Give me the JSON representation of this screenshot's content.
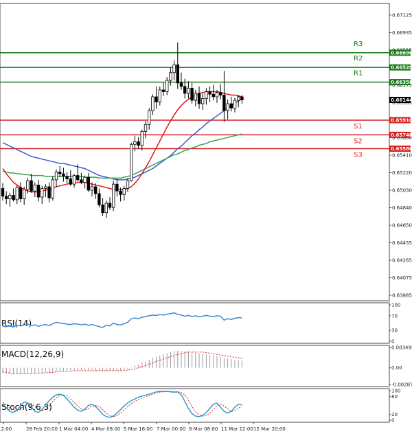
{
  "chart_data": {
    "type": "candlestick",
    "main": {
      "price_axis_ticks": [
        "0.67125",
        "0.66935",
        "0.66555",
        "0.66365",
        "0.66175",
        "0.65985",
        "0.65790",
        "0.65600",
        "0.65410",
        "0.65220",
        "0.65030",
        "0.64840",
        "0.64650",
        "0.64455",
        "0.64265",
        "0.64075",
        "0.63885"
      ],
      "ylim": [
        0.63885,
        0.67125
      ],
      "current_price": "0.66144",
      "resistance": [
        {
          "name": "R3",
          "value": "0.66690"
        },
        {
          "name": "R2",
          "value": "0.66520"
        },
        {
          "name": "R1",
          "value": "0.66350"
        }
      ],
      "support": [
        {
          "name": "S1",
          "value": "0.65910"
        },
        {
          "name": "S2",
          "value": "0.65740"
        },
        {
          "name": "S3",
          "value": "0.65580"
        }
      ],
      "x_labels": [
        "12:00",
        "28 Feb 20:00",
        "1 Mar 04:00",
        "4 Mar 08:00",
        "5 Mar 16:00",
        "7 Mar 00:00",
        "8 Mar 08:00",
        "11 Mar 12:00",
        "12 Mar 20:00"
      ],
      "candles": [
        [
          0.6512,
          0.6518,
          0.6498,
          0.6503
        ],
        [
          0.6503,
          0.6509,
          0.6494,
          0.65
        ],
        [
          0.65,
          0.6507,
          0.6491,
          0.6504
        ],
        [
          0.6504,
          0.6512,
          0.6497,
          0.6499
        ],
        [
          0.6499,
          0.6516,
          0.6494,
          0.6513
        ],
        [
          0.6513,
          0.6519,
          0.6496,
          0.65
        ],
        [
          0.65,
          0.6514,
          0.6493,
          0.6511
        ],
        [
          0.6511,
          0.6524,
          0.6506,
          0.6521
        ],
        [
          0.6521,
          0.6529,
          0.6507,
          0.6509
        ],
        [
          0.6509,
          0.6519,
          0.6502,
          0.6516
        ],
        [
          0.6516,
          0.6522,
          0.6497,
          0.6502
        ],
        [
          0.6502,
          0.6515,
          0.6494,
          0.6512
        ],
        [
          0.6512,
          0.6517,
          0.6502,
          0.6514
        ],
        [
          0.6514,
          0.6519,
          0.6496,
          0.6501
        ],
        [
          0.6501,
          0.6526,
          0.6498,
          0.6522
        ],
        [
          0.6522,
          0.6534,
          0.6514,
          0.6531
        ],
        [
          0.6531,
          0.6538,
          0.6525,
          0.6529
        ],
        [
          0.6529,
          0.6536,
          0.652,
          0.6526
        ],
        [
          0.6526,
          0.6531,
          0.6518,
          0.6523
        ],
        [
          0.6523,
          0.6533,
          0.6515,
          0.6517
        ],
        [
          0.6517,
          0.6529,
          0.6513,
          0.6527
        ],
        [
          0.6527,
          0.654,
          0.652,
          0.6522
        ],
        [
          0.6522,
          0.653,
          0.6517,
          0.6519
        ],
        [
          0.6519,
          0.6527,
          0.6512,
          0.6525
        ],
        [
          0.6525,
          0.653,
          0.6508,
          0.651
        ],
        [
          0.651,
          0.6519,
          0.6503,
          0.6514
        ],
        [
          0.6514,
          0.6518,
          0.65,
          0.6506
        ],
        [
          0.6506,
          0.6512,
          0.649,
          0.6493
        ],
        [
          0.6493,
          0.6501,
          0.648,
          0.6484
        ],
        [
          0.6484,
          0.6498,
          0.6478,
          0.6495
        ],
        [
          0.6495,
          0.6502,
          0.6487,
          0.649
        ],
        [
          0.649,
          0.6521,
          0.6486,
          0.6517
        ],
        [
          0.6517,
          0.6523,
          0.6503,
          0.6509
        ],
        [
          0.6509,
          0.6513,
          0.6497,
          0.6505
        ],
        [
          0.6505,
          0.6515,
          0.6498,
          0.6512
        ],
        [
          0.6512,
          0.6524,
          0.6508,
          0.6521
        ],
        [
          0.6521,
          0.6565,
          0.652,
          0.6563
        ],
        [
          0.6563,
          0.6573,
          0.6555,
          0.6566
        ],
        [
          0.6566,
          0.6571,
          0.6558,
          0.6562
        ],
        [
          0.6562,
          0.658,
          0.6556,
          0.6578
        ],
        [
          0.6578,
          0.659,
          0.657,
          0.6586
        ],
        [
          0.6586,
          0.6605,
          0.658,
          0.6602
        ],
        [
          0.6602,
          0.6621,
          0.6597,
          0.6618
        ],
        [
          0.6618,
          0.663,
          0.6604,
          0.6612
        ],
        [
          0.6612,
          0.663,
          0.6608,
          0.6626
        ],
        [
          0.6626,
          0.6634,
          0.6619,
          0.6624
        ],
        [
          0.6624,
          0.6641,
          0.662,
          0.6637
        ],
        [
          0.6637,
          0.6652,
          0.6631,
          0.6646
        ],
        [
          0.6646,
          0.666,
          0.6637,
          0.6655
        ],
        [
          0.6655,
          0.6681,
          0.6627,
          0.6634
        ],
        [
          0.6634,
          0.6646,
          0.6626,
          0.663
        ],
        [
          0.663,
          0.6639,
          0.6616,
          0.6622
        ],
        [
          0.6622,
          0.6636,
          0.6616,
          0.6628
        ],
        [
          0.6628,
          0.6634,
          0.661,
          0.6614
        ],
        [
          0.6614,
          0.6626,
          0.6607,
          0.6622
        ],
        [
          0.6622,
          0.663,
          0.6604,
          0.661
        ],
        [
          0.661,
          0.6622,
          0.6603,
          0.6616
        ],
        [
          0.6616,
          0.6628,
          0.6609,
          0.6624
        ],
        [
          0.6624,
          0.663,
          0.6612,
          0.6621
        ],
        [
          0.6621,
          0.6632,
          0.6614,
          0.6618
        ],
        [
          0.6618,
          0.6626,
          0.6611,
          0.6623
        ],
        [
          0.6623,
          0.6633,
          0.6615,
          0.662
        ],
        [
          0.662,
          0.6648,
          0.6589,
          0.6602
        ],
        [
          0.6602,
          0.6615,
          0.6592,
          0.661
        ],
        [
          0.661,
          0.6618,
          0.6601,
          0.6605
        ],
        [
          0.6605,
          0.6617,
          0.66,
          0.6614
        ],
        [
          0.6614,
          0.662,
          0.6606,
          0.6618
        ],
        [
          0.6618,
          0.662,
          0.661,
          0.66144
        ]
      ],
      "sma_red": [
        0.6535,
        0.6529,
        0.6524,
        0.6519,
        0.6516,
        0.6513,
        0.6511,
        0.6509,
        0.6508,
        0.6508,
        0.6508,
        0.6509,
        0.651,
        0.6511,
        0.6512,
        0.6514,
        0.6515,
        0.6516,
        0.6517,
        0.6518,
        0.6518,
        0.6519,
        0.6519,
        0.6519,
        0.6518,
        0.6517,
        0.6516,
        0.6515,
        0.6514,
        0.6513,
        0.6512,
        0.6511,
        0.6511,
        0.6511,
        0.6511,
        0.6512,
        0.6514,
        0.6518,
        0.6523,
        0.6529,
        0.6536,
        0.6543,
        0.6551,
        0.6559,
        0.6567,
        0.6575,
        0.6583,
        0.659,
        0.6597,
        0.6603,
        0.6608,
        0.6612,
        0.6615,
        0.6618,
        0.662,
        0.6622,
        0.6623,
        0.6624,
        0.6624,
        0.6624,
        0.6624,
        0.6623,
        0.6622,
        0.6621,
        0.662,
        0.662,
        0.6619,
        0.6618
      ],
      "sma_blue": [
        0.6565,
        0.6563,
        0.6561,
        0.6559,
        0.6557,
        0.6555,
        0.6553,
        0.6551,
        0.6549,
        0.6548,
        0.6547,
        0.6546,
        0.6545,
        0.6544,
        0.6543,
        0.6542,
        0.6541,
        0.6541,
        0.654,
        0.6539,
        0.6538,
        0.6537,
        0.6536,
        0.6535,
        0.6533,
        0.6531,
        0.6529,
        0.6527,
        0.6526,
        0.6525,
        0.6524,
        0.6523,
        0.6522,
        0.6522,
        0.6522,
        0.6523,
        0.6524,
        0.6525,
        0.6527,
        0.6529,
        0.6531,
        0.6533,
        0.6535,
        0.6538,
        0.6541,
        0.6544,
        0.6547,
        0.655,
        0.6554,
        0.6558,
        0.6561,
        0.6565,
        0.6569,
        0.6573,
        0.6576,
        0.658,
        0.6583,
        0.6587,
        0.659,
        0.6593,
        0.6596,
        0.6599,
        0.6602,
        0.6605,
        0.6608,
        0.6611,
        0.6613,
        0.6616
      ],
      "sma_green": [
        0.6532,
        0.6531,
        0.653,
        0.653,
        0.6529,
        0.6529,
        0.6528,
        0.6528,
        0.6527,
        0.6527,
        0.6527,
        0.6527,
        0.6526,
        0.6526,
        0.6526,
        0.6526,
        0.6526,
        0.6526,
        0.6526,
        0.6526,
        0.6526,
        0.6526,
        0.6526,
        0.6525,
        0.6525,
        0.6525,
        0.6525,
        0.6524,
        0.6524,
        0.6524,
        0.6524,
        0.6524,
        0.6524,
        0.6524,
        0.6525,
        0.6526,
        0.6527,
        0.6529,
        0.6531,
        0.6533,
        0.6535,
        0.6537,
        0.6539,
        0.6541,
        0.6543,
        0.6545,
        0.6547,
        0.6549,
        0.6551,
        0.6552,
        0.6554,
        0.6556,
        0.6557,
        0.6559,
        0.656,
        0.6562,
        0.6563,
        0.6564,
        0.6566,
        0.6567,
        0.6568,
        0.6569,
        0.657,
        0.6571,
        0.6572,
        0.6573,
        0.6574,
        0.6575
      ]
    },
    "rsi": {
      "label": "RSI(14)",
      "ticks": [
        "100",
        "70",
        "30",
        "0"
      ],
      "ylim": [
        0,
        100
      ],
      "values": [
        41,
        40,
        42,
        39,
        44,
        42,
        45,
        47,
        43,
        45,
        41,
        44,
        46,
        43,
        48,
        52,
        50,
        49,
        47,
        46,
        48,
        47,
        45,
        47,
        44,
        46,
        43,
        40,
        38,
        44,
        42,
        50,
        46,
        45,
        48,
        52,
        62,
        64,
        62,
        66,
        68,
        70,
        72,
        71,
        73,
        72,
        74,
        76,
        78,
        74,
        72,
        69,
        71,
        68,
        70,
        67,
        69,
        71,
        69,
        68,
        70,
        69,
        58,
        62,
        60,
        63,
        65,
        64
      ]
    },
    "macd": {
      "label": "MACD(12,26,9)",
      "ticks": [
        "0.003495",
        "0.00",
        "-0.00287"
      ],
      "ylim": [
        -0.00287,
        0.003495
      ],
      "histogram": [
        -0.0009,
        -0.001,
        -0.001,
        -0.0011,
        -0.0011,
        -0.0011,
        -0.001,
        -0.001,
        -0.0009,
        -0.0009,
        -0.0009,
        -0.0008,
        -0.0008,
        -0.0008,
        -0.0007,
        -0.0006,
        -0.0006,
        -0.0005,
        -0.0005,
        -0.0005,
        -0.0004,
        -0.0004,
        -0.0004,
        -0.0004,
        -0.0004,
        -0.0004,
        -0.0005,
        -0.0005,
        -0.0006,
        -0.0006,
        -0.0006,
        -0.0005,
        -0.0005,
        -0.0005,
        -0.0004,
        -0.0003,
        0.0001,
        0.0004,
        0.0006,
        0.0009,
        0.0011,
        0.0014,
        0.0017,
        0.0019,
        0.0021,
        0.0023,
        0.0025,
        0.0027,
        0.0029,
        0.0029,
        0.0029,
        0.0028,
        0.0028,
        0.0027,
        0.0026,
        0.0025,
        0.0024,
        0.0023,
        0.0022,
        0.0021,
        0.002,
        0.0019,
        0.0017,
        0.0016,
        0.0015,
        0.0014,
        0.0013,
        0.0012
      ],
      "signal": [
        -0.0007,
        -0.0008,
        -0.0009,
        -0.001,
        -0.001,
        -0.001,
        -0.001,
        -0.001,
        -0.001,
        -0.001,
        -0.0009,
        -0.0009,
        -0.0009,
        -0.0008,
        -0.0008,
        -0.0007,
        -0.0007,
        -0.0006,
        -0.0006,
        -0.0006,
        -0.0005,
        -0.0005,
        -0.0005,
        -0.0005,
        -0.0005,
        -0.0005,
        -0.0005,
        -0.0005,
        -0.0005,
        -0.0005,
        -0.0005,
        -0.0005,
        -0.0005,
        -0.0005,
        -0.0005,
        -0.0004,
        -0.0003,
        -0.0002,
        0.0,
        0.0002,
        0.0004,
        0.0006,
        0.0008,
        0.0011,
        0.0013,
        0.0015,
        0.0017,
        0.0019,
        0.0021,
        0.0023,
        0.0024,
        0.0026,
        0.0027,
        0.0027,
        0.0027,
        0.0027,
        0.0027,
        0.0026,
        0.0025,
        0.0024,
        0.0023,
        0.0022,
        0.0021,
        0.002,
        0.0019,
        0.0018,
        0.0017,
        0.0016
      ]
    },
    "stoch": {
      "label": "Stoch(9,6,3)",
      "ticks": [
        "100",
        "80",
        "20",
        "0"
      ],
      "ylim": [
        0,
        100
      ],
      "k": [
        55,
        42,
        30,
        26,
        34,
        48,
        62,
        58,
        44,
        30,
        26,
        36,
        52,
        66,
        78,
        86,
        88,
        84,
        72,
        58,
        44,
        34,
        30,
        38,
        50,
        54,
        46,
        34,
        20,
        12,
        10,
        14,
        24,
        36,
        48,
        58,
        66,
        72,
        78,
        82,
        85,
        88,
        92,
        96,
        98,
        97,
        98,
        96,
        95,
        96,
        86,
        64,
        40,
        22,
        14,
        12,
        16,
        26,
        40,
        54,
        58,
        44,
        30,
        24,
        30,
        44,
        54,
        52
      ],
      "d": [
        60,
        52,
        42,
        34,
        32,
        38,
        50,
        58,
        56,
        46,
        36,
        32,
        38,
        50,
        64,
        76,
        84,
        86,
        82,
        72,
        60,
        48,
        38,
        34,
        40,
        48,
        50,
        46,
        36,
        24,
        16,
        12,
        16,
        24,
        36,
        46,
        56,
        64,
        70,
        76,
        80,
        84,
        88,
        92,
        95,
        96,
        97,
        97,
        96,
        96,
        94,
        86,
        68,
        46,
        28,
        18,
        14,
        16,
        24,
        36,
        48,
        54,
        48,
        38,
        30,
        32,
        40,
        48
      ]
    }
  }
}
